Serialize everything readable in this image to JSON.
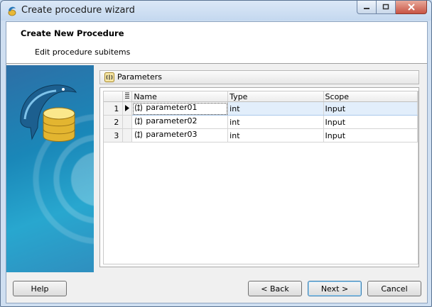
{
  "window": {
    "title": "Create procedure wizard"
  },
  "header": {
    "title": "Create New Procedure",
    "subtitle": "Edit procedure subitems"
  },
  "panel": {
    "title": "Parameters"
  },
  "grid": {
    "columns": [
      "Name",
      "Type",
      "Scope"
    ],
    "rows": [
      {
        "num": "1",
        "name": "parameter01",
        "type": "int",
        "scope": "Input",
        "selected": true
      },
      {
        "num": "2",
        "name": "parameter02",
        "type": "int",
        "scope": "Input",
        "selected": false
      },
      {
        "num": "3",
        "name": "parameter03",
        "type": "int",
        "scope": "Input",
        "selected": false
      }
    ]
  },
  "buttons": {
    "help": "Help",
    "back": "< Back",
    "next": "Next >",
    "cancel": "Cancel"
  },
  "colors": {
    "accent": "#3c7fb1",
    "selection": "#e2eefb"
  }
}
